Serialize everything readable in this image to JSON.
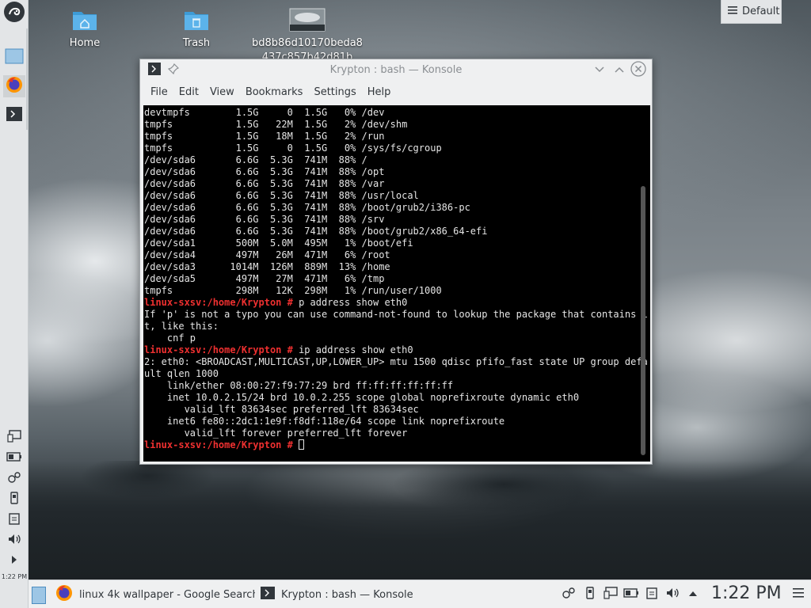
{
  "desktop": {
    "icons": [
      {
        "label": "Home",
        "icon": "folder-home-icon"
      },
      {
        "label": "Trash",
        "icon": "trash-folder-icon"
      },
      {
        "label": "bd8b86d10170beda8437c857b42d81b",
        "icon": "image-thumbnail-icon"
      }
    ],
    "activities_button": {
      "label": "Default",
      "icon": "hamburger-icon"
    }
  },
  "left_panel": {
    "items": [
      {
        "name": "opensuse-launcher",
        "icon": "chameleon-icon"
      },
      {
        "name": "desktop-pager",
        "icon": "pager-icon"
      },
      {
        "name": "firefox",
        "icon": "firefox-icon"
      },
      {
        "name": "konsole",
        "icon": "terminal-icon"
      }
    ],
    "tray": [
      "display-icon",
      "battery-icon",
      "network-icon",
      "usb-icon",
      "clipboard-icon",
      "volume-icon",
      "expand-icon"
    ],
    "clock": "1:22 PM"
  },
  "window": {
    "title": "Krypton : bash — Konsole",
    "menu": [
      "File",
      "Edit",
      "View",
      "Bookmarks",
      "Settings",
      "Help"
    ],
    "terminal_lines": [
      {
        "text": "devtmpfs        1.5G     0  1.5G   0% /dev"
      },
      {
        "text": "tmpfs           1.5G   22M  1.5G   2% /dev/shm"
      },
      {
        "text": "tmpfs           1.5G   18M  1.5G   2% /run"
      },
      {
        "text": "tmpfs           1.5G     0  1.5G   0% /sys/fs/cgroup"
      },
      {
        "text": "/dev/sda6       6.6G  5.3G  741M  88% /"
      },
      {
        "text": "/dev/sda6       6.6G  5.3G  741M  88% /opt"
      },
      {
        "text": "/dev/sda6       6.6G  5.3G  741M  88% /var"
      },
      {
        "text": "/dev/sda6       6.6G  5.3G  741M  88% /usr/local"
      },
      {
        "text": "/dev/sda6       6.6G  5.3G  741M  88% /boot/grub2/i386-pc"
      },
      {
        "text": "/dev/sda6       6.6G  5.3G  741M  88% /srv"
      },
      {
        "text": "/dev/sda6       6.6G  5.3G  741M  88% /boot/grub2/x86_64-efi"
      },
      {
        "text": "/dev/sda1       500M  5.0M  495M   1% /boot/efi"
      },
      {
        "text": "/dev/sda4       497M   26M  471M   6% /root"
      },
      {
        "text": "/dev/sda3      1014M  126M  889M  13% /home"
      },
      {
        "text": "/dev/sda5       497M   27M  471M   6% /tmp"
      },
      {
        "text": "tmpfs           298M   12K  298M   1% /run/user/1000"
      },
      {
        "prompt": "linux-sxsv:/home/Krypton # ",
        "text": "p address show eth0"
      },
      {
        "text": "If 'p' is not a typo you can use command-not-found to lookup the package that contains i"
      },
      {
        "text": "t, like this:"
      },
      {
        "text": "    cnf p"
      },
      {
        "prompt": "linux-sxsv:/home/Krypton # ",
        "text": "ip address show eth0"
      },
      {
        "text": "2: eth0: <BROADCAST,MULTICAST,UP,LOWER_UP> mtu 1500 qdisc pfifo_fast state UP group defa"
      },
      {
        "text": "ult qlen 1000"
      },
      {
        "text": "    link/ether 08:00:27:f9:77:29 brd ff:ff:ff:ff:ff:ff"
      },
      {
        "text": "    inet 10.0.2.15/24 brd 10.0.2.255 scope global noprefixroute dynamic eth0"
      },
      {
        "text": "       valid_lft 83634sec preferred_lft 83634sec"
      },
      {
        "text": "    inet6 fe80::2dc1:1e9f:f8df:118e/64 scope link noprefixroute"
      },
      {
        "text": "       valid_lft forever preferred_lft forever"
      },
      {
        "prompt": "linux-sxsv:/home/Krypton # ",
        "text": "",
        "cursor": true
      }
    ]
  },
  "taskbar": {
    "tasks": [
      {
        "label": "linux 4k wallpaper - Google Search...",
        "icon": "firefox-icon"
      },
      {
        "label": "Krypton : bash — Konsole",
        "icon": "terminal-icon"
      }
    ],
    "clock": "1:22 PM",
    "tray": [
      "network-icon",
      "usb-icon",
      "display-icon",
      "battery-icon",
      "clipboard-icon",
      "volume-icon",
      "expand-arrow-icon",
      "menu-icon"
    ]
  },
  "colors": {
    "prompt": "#ef3030",
    "terminal_bg": "#000000",
    "panel_bg": "#eff0f1",
    "accent": "#3daee9"
  }
}
